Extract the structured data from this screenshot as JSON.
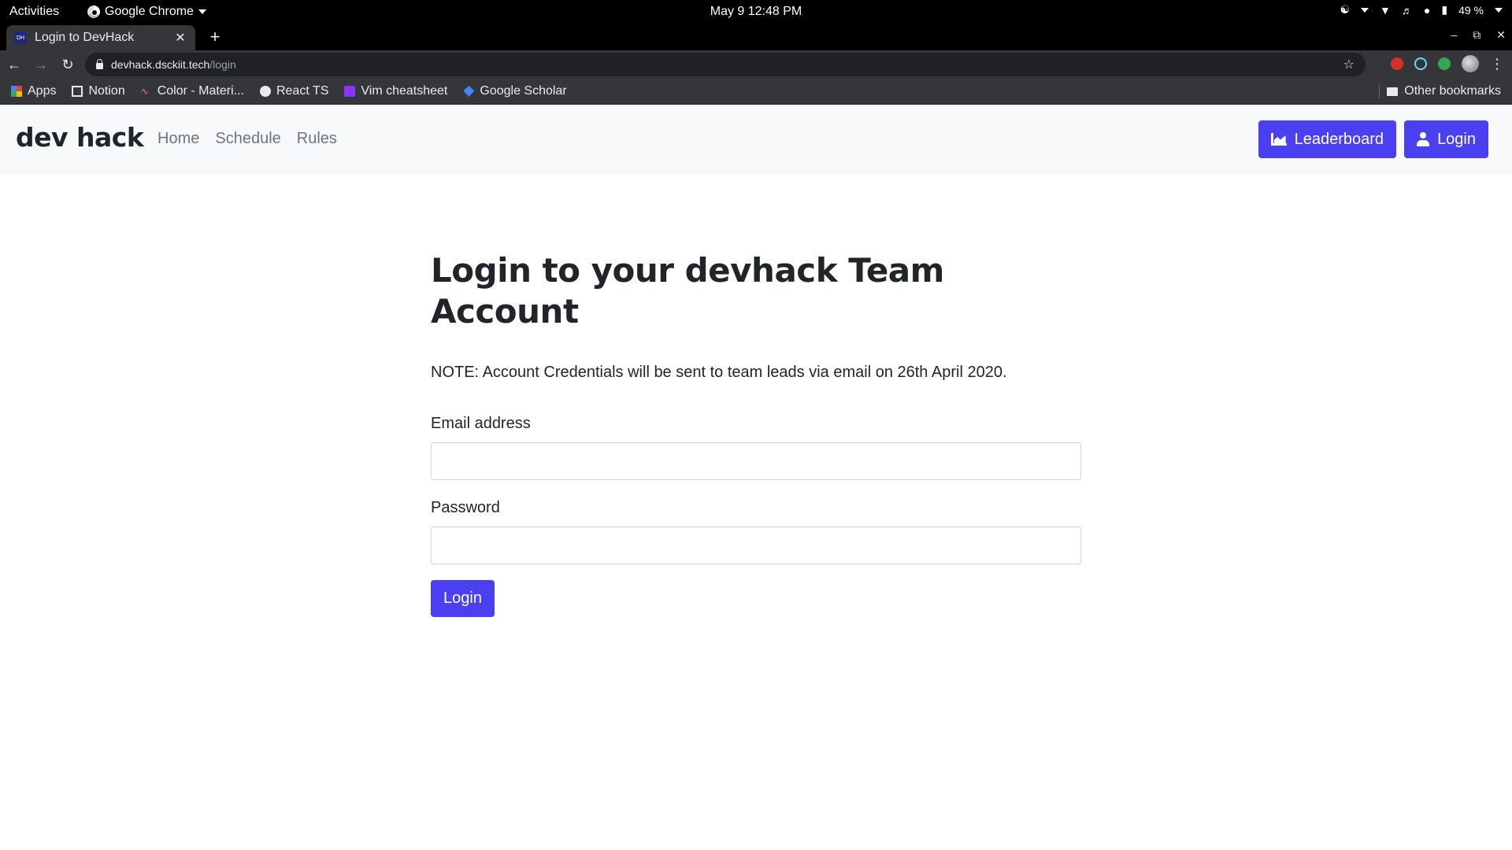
{
  "os_bar": {
    "activities": "Activities",
    "app_name": "Google Chrome",
    "clock": "May 9  12:48 PM",
    "battery": "49 %"
  },
  "browser": {
    "tab_title": "Login to DevHack",
    "tab_favicon_text": "DH",
    "url_host": "devhack.dsckiit.tech",
    "url_path": "/login",
    "bookmarks": [
      "Apps",
      "Notion",
      "Color - Materi...",
      "React TS",
      "Vim cheatsheet",
      "Google Scholar"
    ],
    "other_bookmarks": "Other bookmarks"
  },
  "site": {
    "brand": "dev hack",
    "nav": [
      "Home",
      "Schedule",
      "Rules"
    ],
    "leaderboard_label": "Leaderboard",
    "login_label": "Login",
    "accent_color": "#4b3ff2"
  },
  "form": {
    "title": "Login to your devhack Team Account",
    "note": "NOTE: Account Credentials will be sent to team leads via email on 26th April 2020.",
    "email_label": "Email address",
    "email_value": "",
    "password_label": "Password",
    "password_value": "",
    "submit_label": "Login"
  }
}
